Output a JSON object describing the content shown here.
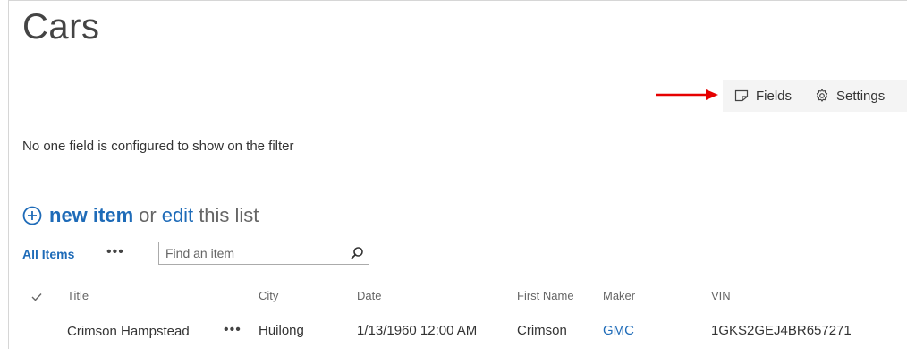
{
  "page": {
    "title": "Cars"
  },
  "toolbar": {
    "fields_label": "Fields",
    "settings_label": "Settings",
    "arrow_color": "#e60000"
  },
  "filter": {
    "message": "No one field is configured to show on the filter"
  },
  "actions": {
    "new_item_label": "new item",
    "or_text": "or",
    "edit_label": "edit",
    "list_text": "this list"
  },
  "views": {
    "current_view": "All Items",
    "more_label": "•••",
    "search_placeholder": "Find an item"
  },
  "list": {
    "columns": [
      "Title",
      "City",
      "Date",
      "First Name",
      "Maker",
      "VIN"
    ],
    "rows": [
      {
        "title": "Crimson Hampstead",
        "more": "•••",
        "city": "Huilong",
        "date": "1/13/1960 12:00 AM",
        "first_name": "Crimson",
        "maker": "GMC",
        "vin": "1GKS2GEJ4BR657271"
      }
    ]
  },
  "colors": {
    "link": "#1e6bb8",
    "toolbar_bg": "#f4f4f4"
  }
}
